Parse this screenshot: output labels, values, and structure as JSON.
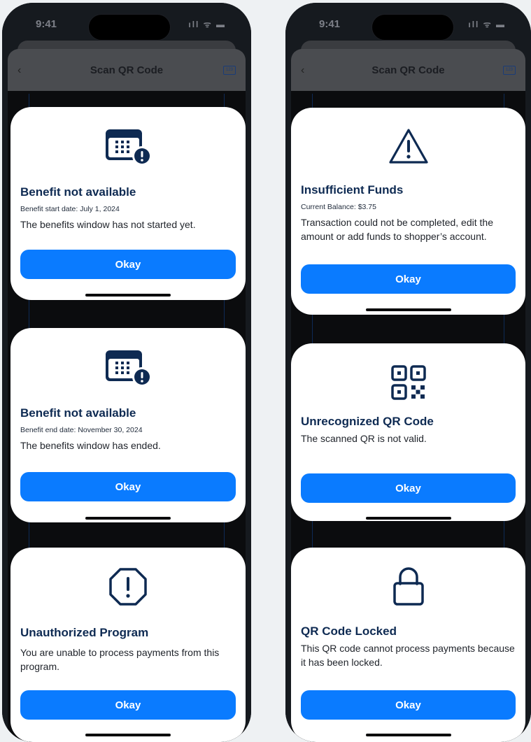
{
  "status": {
    "time": "9:41",
    "icons": "ıll ᯤ ▬"
  },
  "navbar": {
    "back": "‹",
    "title": "Scan QR Code",
    "kbd": "123"
  },
  "left": {
    "cards": [
      {
        "icon": "calendar-alert-icon",
        "title": "Benefit not available",
        "small": "Benefit start date: July 1, 2024",
        "message": "The benefits window has not started yet.",
        "button": "Okay"
      },
      {
        "icon": "calendar-alert-icon",
        "title": "Benefit not available",
        "small": "Benefit end date: November 30, 2024",
        "message": "The benefits window has ended.",
        "button": "Okay"
      },
      {
        "icon": "octagon-alert-icon",
        "title": "Unauthorized Program",
        "message": "You are unable to process payments from this program.",
        "button": "Okay"
      }
    ]
  },
  "right": {
    "cards": [
      {
        "icon": "warning-triangle-icon",
        "title": "Insufficient Funds",
        "small": "Current Balance: $3.75",
        "message": "Transaction could not be completed, edit the amount or add funds to shopper’s account.",
        "button": "Okay"
      },
      {
        "icon": "qr-code-icon",
        "title": "Unrecognized QR Code",
        "message": "The scanned QR is not valid.",
        "button": "Okay"
      },
      {
        "icon": "lock-icon",
        "title": "QR Code Locked",
        "message": "This QR code cannot process payments because it has been locked.",
        "button": "Okay"
      }
    ]
  },
  "colors": {
    "primary_button": "#0a7bff",
    "title": "#0e2a52",
    "icon": "#0e2a52"
  }
}
